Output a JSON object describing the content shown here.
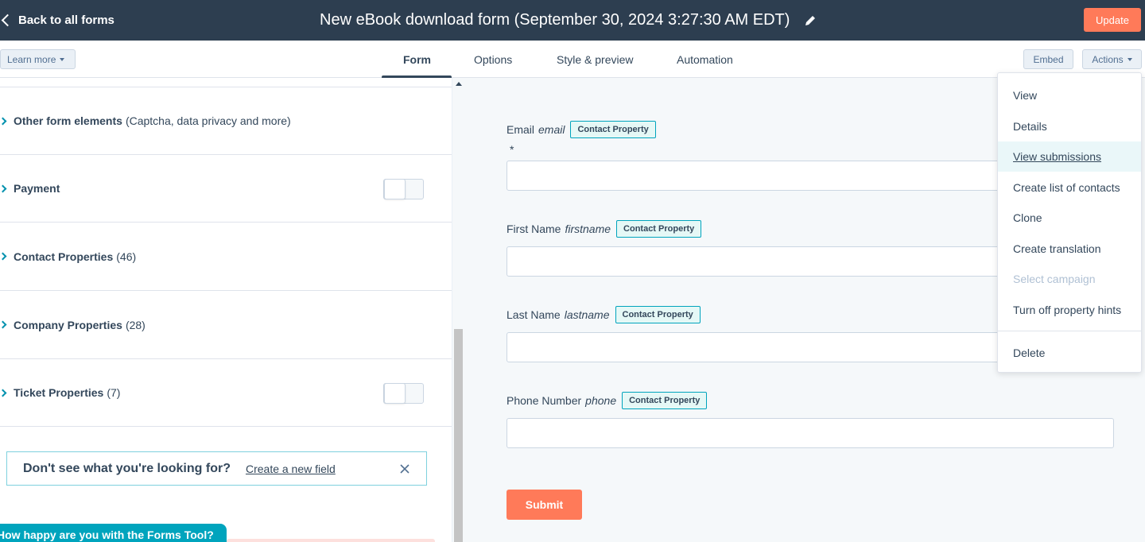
{
  "header": {
    "back_label": "Back to all forms",
    "title": "New eBook download form (September 30, 2024 3:27:30 AM EDT)",
    "update_label": "Update"
  },
  "subbar": {
    "learn_more": "Learn more",
    "tabs": [
      {
        "label": "Form",
        "active": true
      },
      {
        "label": "Options",
        "active": false
      },
      {
        "label": "Style & preview",
        "active": false
      },
      {
        "label": "Automation",
        "active": false
      }
    ],
    "embed_label": "Embed",
    "actions_label": "Actions"
  },
  "left": {
    "sections": [
      {
        "title": "Other form elements",
        "extra": "(Captcha, data privacy and more)"
      },
      {
        "title": "Payment",
        "extra": ""
      },
      {
        "title": "Contact Properties",
        "extra": "(46)"
      },
      {
        "title": "Company Properties",
        "extra": "(28)"
      },
      {
        "title": "Ticket Properties",
        "extra": "(7)"
      }
    ],
    "hint_question": "Don't see what you're looking for?",
    "hint_link": "Create a new field",
    "feedback": "How happy are you with the Forms Tool?"
  },
  "form": {
    "fields": [
      {
        "label": "Email",
        "name": "email",
        "badge": "Contact Property"
      },
      {
        "label": "First Name",
        "name": "firstname",
        "badge": "Contact Property"
      },
      {
        "label": "Last Name",
        "name": "lastname",
        "badge": "Contact Property"
      },
      {
        "label": "Phone Number",
        "name": "phone",
        "badge": "Contact Property"
      }
    ],
    "required_mark": "*",
    "submit_label": "Submit"
  },
  "actions_menu": {
    "items": [
      {
        "label": "View",
        "state": "normal"
      },
      {
        "label": "Details",
        "state": "normal"
      },
      {
        "label": "View submissions",
        "state": "hover"
      },
      {
        "label": "Create list of contacts",
        "state": "normal"
      },
      {
        "label": "Clone",
        "state": "normal"
      },
      {
        "label": "Create translation",
        "state": "normal"
      },
      {
        "label": "Select campaign",
        "state": "disabled"
      },
      {
        "label": "Turn off property hints",
        "state": "normal"
      },
      {
        "label": "Delete",
        "state": "normal"
      }
    ]
  },
  "colors": {
    "header_bg": "#2d3e50",
    "accent_orange": "#ff7a59",
    "teal": "#00a4bd"
  }
}
